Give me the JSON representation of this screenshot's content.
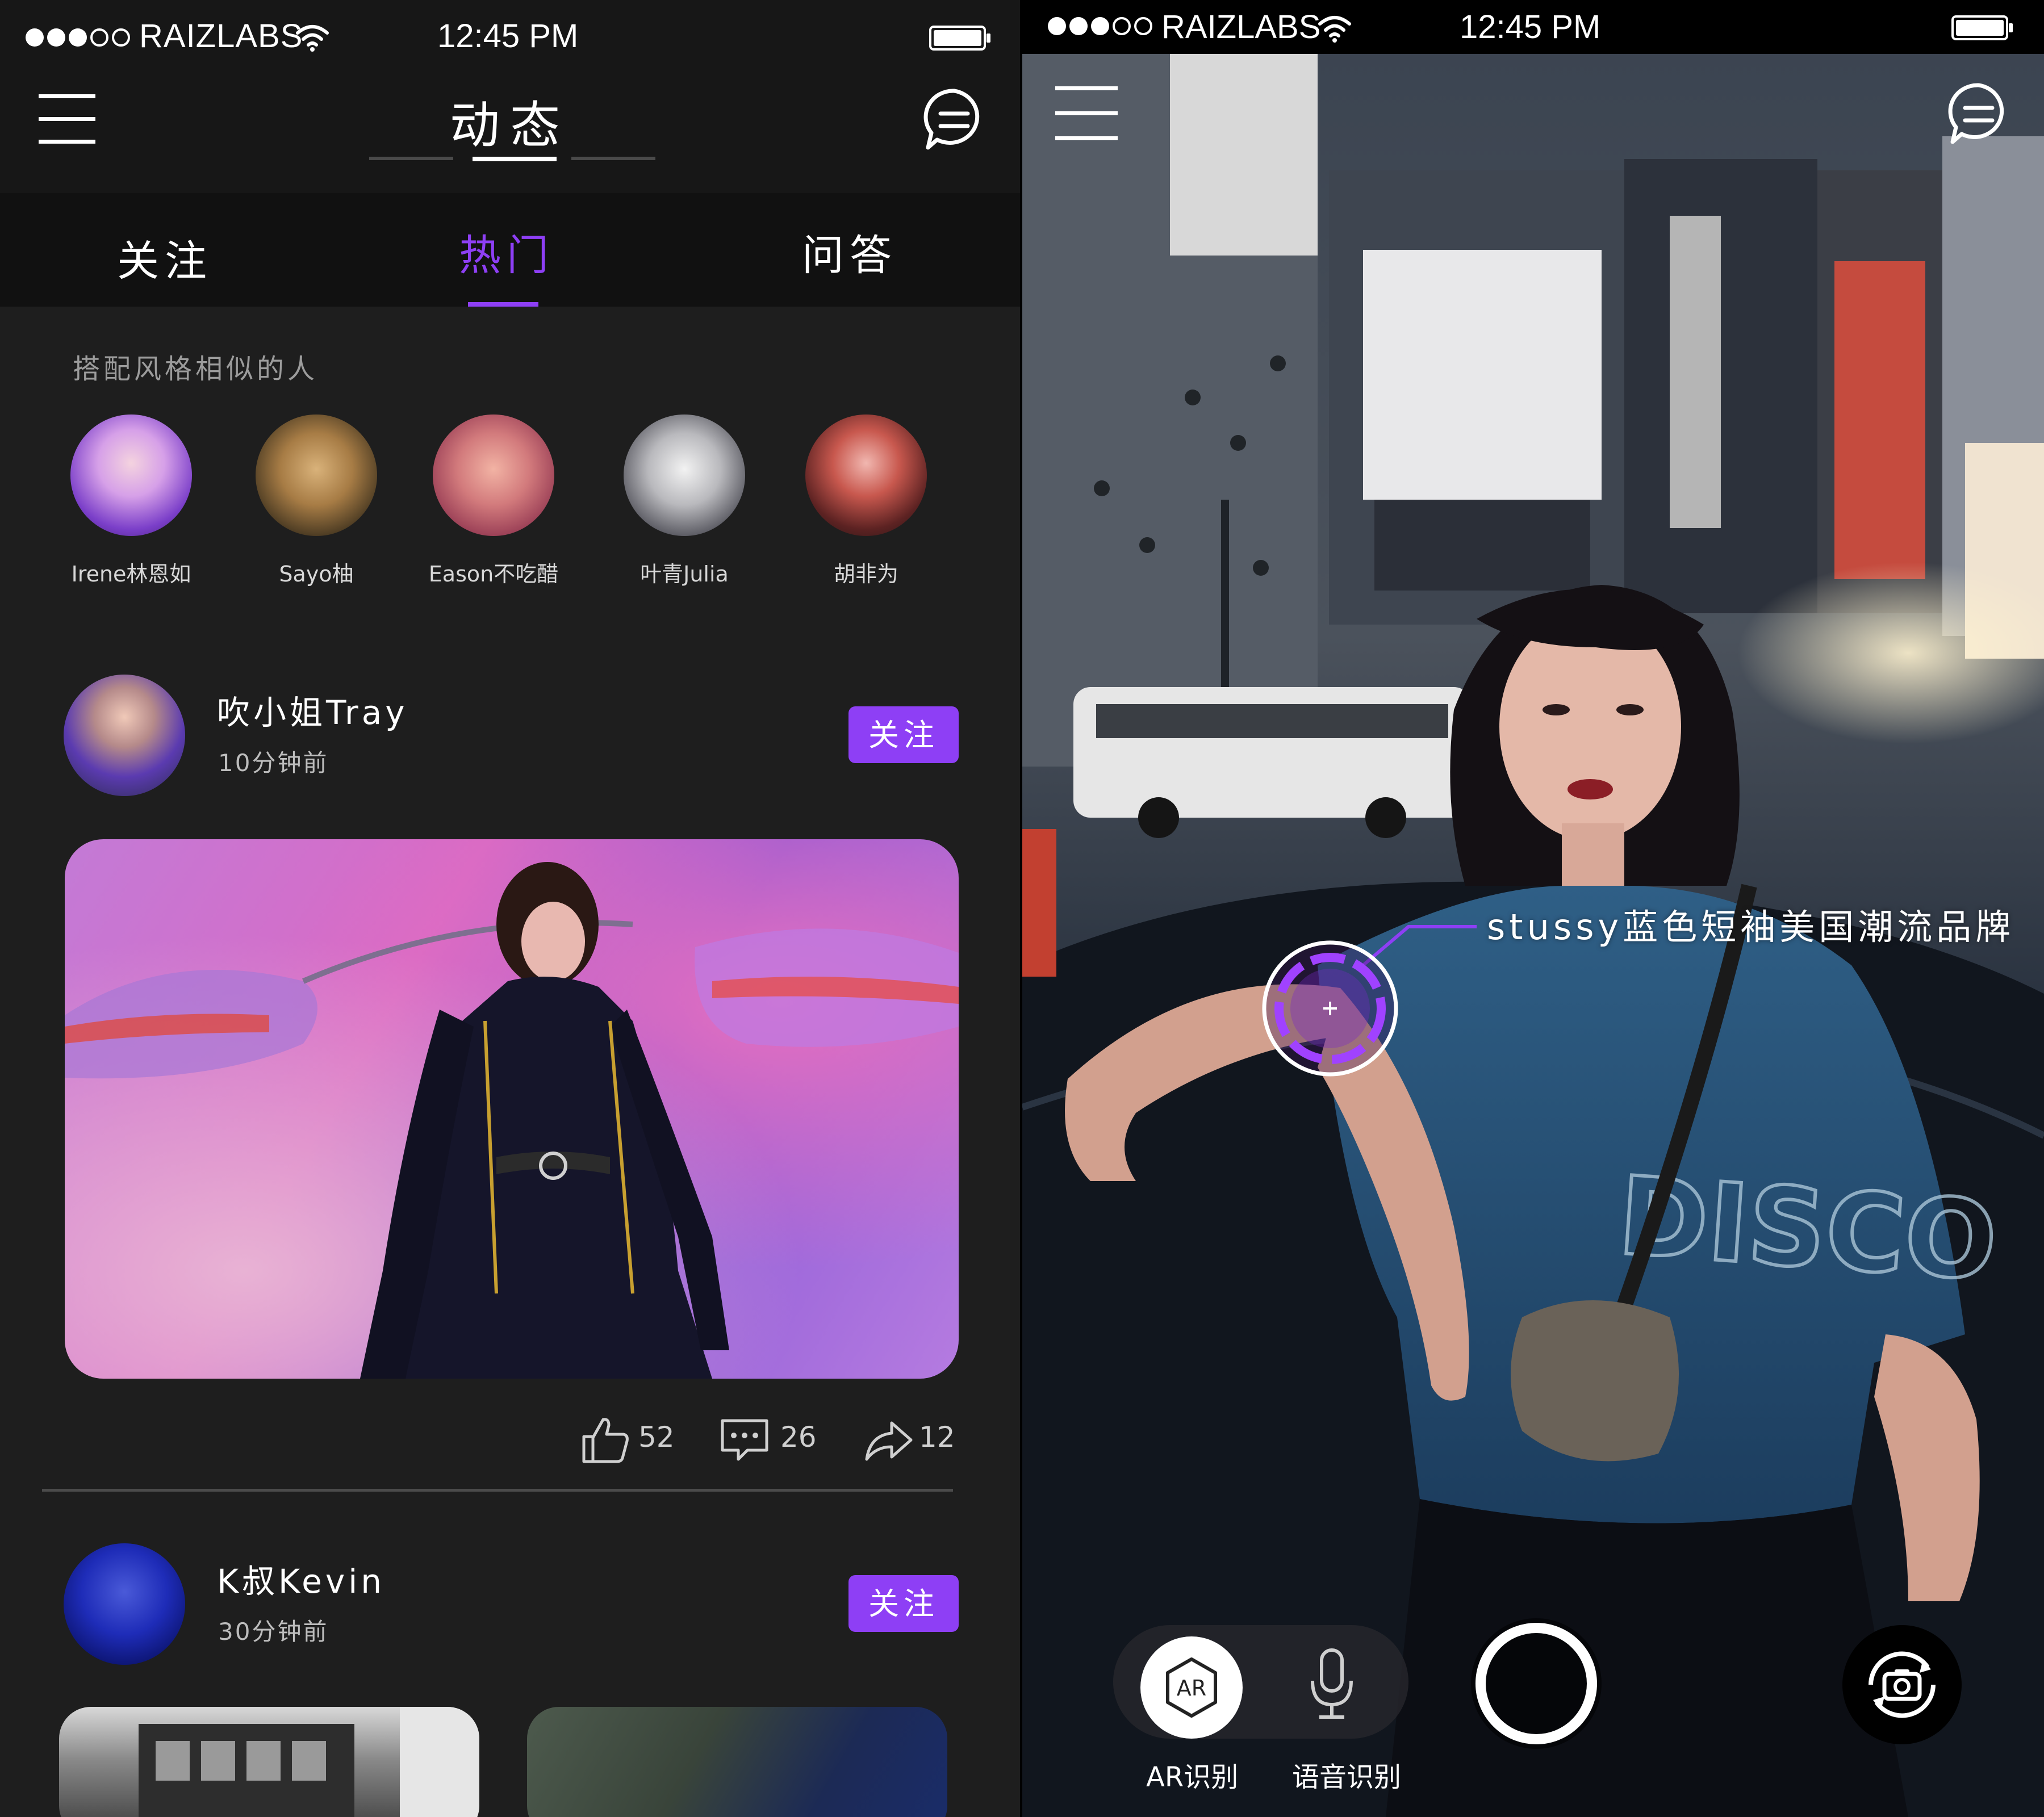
{
  "status_bar": {
    "carrier": "RAIZLABS",
    "time": "12:45 PM"
  },
  "feed": {
    "title": "动态",
    "tabs": [
      {
        "label": "关注",
        "active": false
      },
      {
        "label": "热门",
        "active": true
      },
      {
        "label": "问答",
        "active": false
      }
    ],
    "similar_section_label": "搭配风格相似的人",
    "similar_people": [
      {
        "name": "Irene林恩如"
      },
      {
        "name": "Sayo柚"
      },
      {
        "name": "Eason不吃醋"
      },
      {
        "name": "叶青Julia"
      },
      {
        "name": "胡非为"
      }
    ],
    "posts": [
      {
        "author": "吹小姐Tray",
        "time": "10分钟前",
        "follow_label": "关注",
        "likes": "52",
        "comments": "26",
        "shares": "12"
      },
      {
        "author": "K叔Kevin",
        "time": "30分钟前",
        "follow_label": "关注"
      }
    ]
  },
  "camera": {
    "ar_tag_label": "stussy蓝色短袖美国潮流品牌",
    "ar_button_text": "AR",
    "mode_ar_label": "AR识别",
    "mode_voice_label": "语音识别"
  },
  "colors": {
    "accent": "#8e3ff5",
    "background": "#1e1e1e",
    "topbar": "#171717",
    "tabbar": "#111111"
  },
  "icons": {
    "menu": "hamburger-menu-icon",
    "chat": "chat-bubble-icon",
    "like": "thumbs-up-icon",
    "comment": "comment-icon",
    "share": "share-arrow-icon",
    "mic": "microphone-icon",
    "camera_flip": "camera-flip-icon",
    "wifi": "wifi-icon",
    "battery": "battery-icon"
  }
}
